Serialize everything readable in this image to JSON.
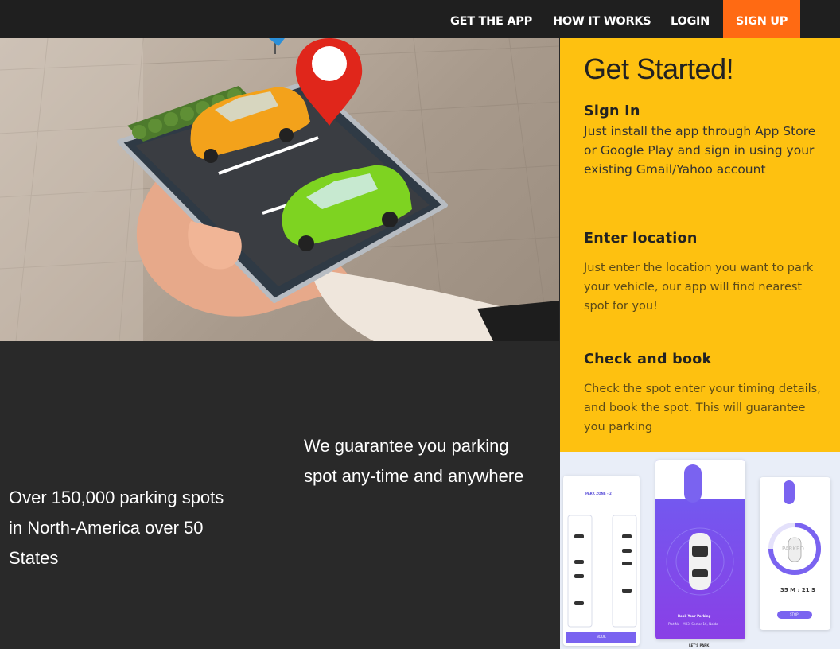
{
  "nav": {
    "get_app": "GET THE APP",
    "how_it_works": "HOW IT WORKS",
    "login": "LOGIN",
    "sign_up": "SIGN UP"
  },
  "hero": {
    "stat": "Over 150,000 parking spots in North-America over 50 States",
    "guarantee": "We guarantee you parking spot any-time and anywhere"
  },
  "get_started": {
    "title": "Get Started!",
    "steps": [
      {
        "heading": "Sign In",
        "text": "Just install the app through App Store or Google Play and sign in using your existing Gmail/Yahoo account"
      },
      {
        "heading": "Enter location",
        "text": "Just enter the location you want to park your vehicle, our app will find nearest spot for you!"
      },
      {
        "heading": "Check and book",
        "text": "Check the spot enter your timing details, and book the spot. This will guarantee  you parking"
      }
    ]
  },
  "app_screens": {
    "zone_title": "PARK ZONE - 2",
    "zones": [
      "ZONE 1",
      "ZONE 2",
      "ZONE 3"
    ],
    "book_label": "Book Your Parking",
    "book_sub": "Plot No - M03, Sector 16, Noida",
    "timer": "35 M : 21 S",
    "parked_label": "PARKED",
    "stop_label": "STOP",
    "book_button": "BOOK",
    "lets_park": "LET'S PARK"
  },
  "colors": {
    "nav_bg": "#1f1f1f",
    "signup_bg": "#ff6a13",
    "panel_bg": "#fec110",
    "dark_bg": "#292929",
    "app_purple": "#6d5ff2"
  }
}
